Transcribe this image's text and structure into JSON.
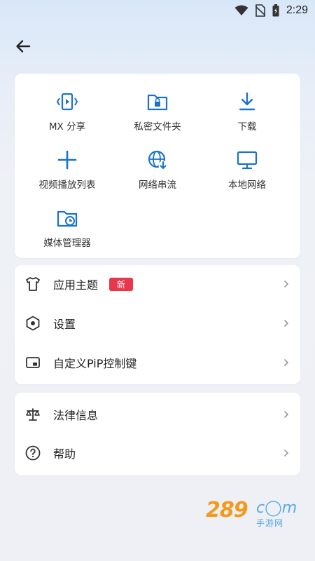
{
  "status_bar": {
    "time": "2:29"
  },
  "grid": {
    "items": [
      {
        "label": "MX 分享",
        "icon": "mx-share-icon"
      },
      {
        "label": "私密文件夹",
        "icon": "private-folder-icon"
      },
      {
        "label": "下载",
        "icon": "download-icon"
      },
      {
        "label": "视频播放列表",
        "icon": "plus-icon"
      },
      {
        "label": "网络串流",
        "icon": "globe-download-icon"
      },
      {
        "label": "本地网络",
        "icon": "monitor-icon"
      },
      {
        "label": "媒体管理器",
        "icon": "media-folder-icon"
      }
    ]
  },
  "settings_list": {
    "items": [
      {
        "label": "应用主题",
        "badge": "新",
        "icon": "tshirt-icon"
      },
      {
        "label": "设置",
        "icon": "hexagon-settings-icon"
      },
      {
        "label": "自定义PiP控制键",
        "icon": "pip-icon"
      }
    ]
  },
  "help_list": {
    "items": [
      {
        "label": "法律信息",
        "icon": "scales-icon"
      },
      {
        "label": "帮助",
        "icon": "question-icon"
      }
    ]
  },
  "watermark": {
    "num": "289",
    "com": "c◯m",
    "sub": "手游网"
  },
  "colors": {
    "accent": "#1a73c9",
    "badge": "#e8364b",
    "watermark_orange": "#f39a1c",
    "watermark_blue": "#5aa9e6"
  }
}
